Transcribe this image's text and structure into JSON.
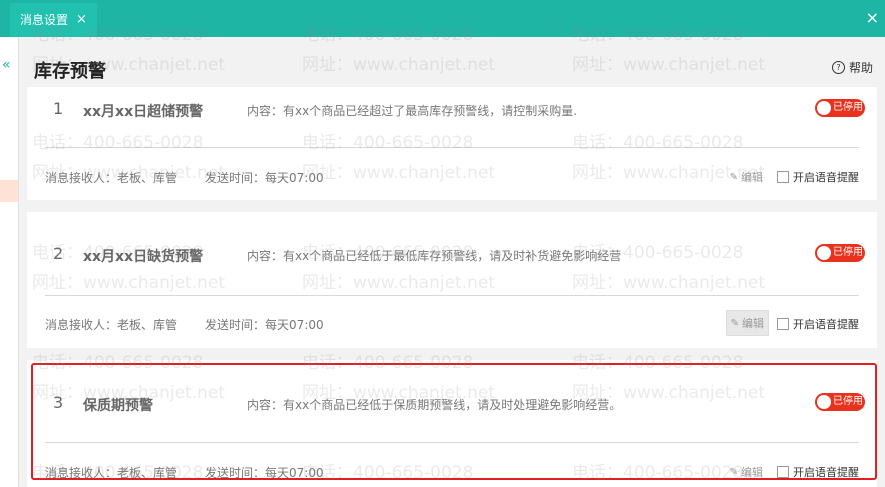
{
  "tab": {
    "label": "消息设置",
    "close": "×"
  },
  "window_close": "×",
  "sidebar": {
    "collapse_icon": "«"
  },
  "page": {
    "title": "库存预警",
    "help_label": "帮助",
    "help_icon": "?"
  },
  "receivers_label": "消息接收人：老板、库管",
  "send_time_label": "发送时间：每天07:00",
  "edit_label": "编辑",
  "voice_label": "开启语音提醒",
  "cards": [
    {
      "num": "1",
      "name": "xx月xx日超储预警",
      "content": "内容：有xx个商品已经超过了最高库存预警线，请控制采购量.",
      "toggle": "已停用"
    },
    {
      "num": "2",
      "name": "xx月xx日缺货预警",
      "content": "内容：有xx个商品已经低于最低库存预警线，请及时补货避免影响经营",
      "toggle": "已停用"
    },
    {
      "num": "3",
      "name": "保质期预警",
      "content": "内容：有xx个商品已经低于保质期预警线，请及时处理避免影响经营。",
      "toggle": "已停用"
    }
  ],
  "watermark": {
    "phone": "电话：400-665-0028",
    "url": "网址：www.chanjet.net"
  },
  "colors": {
    "topbar": "#1fb5a5",
    "toggle": "#e8321e",
    "highlight": "#e02020"
  }
}
